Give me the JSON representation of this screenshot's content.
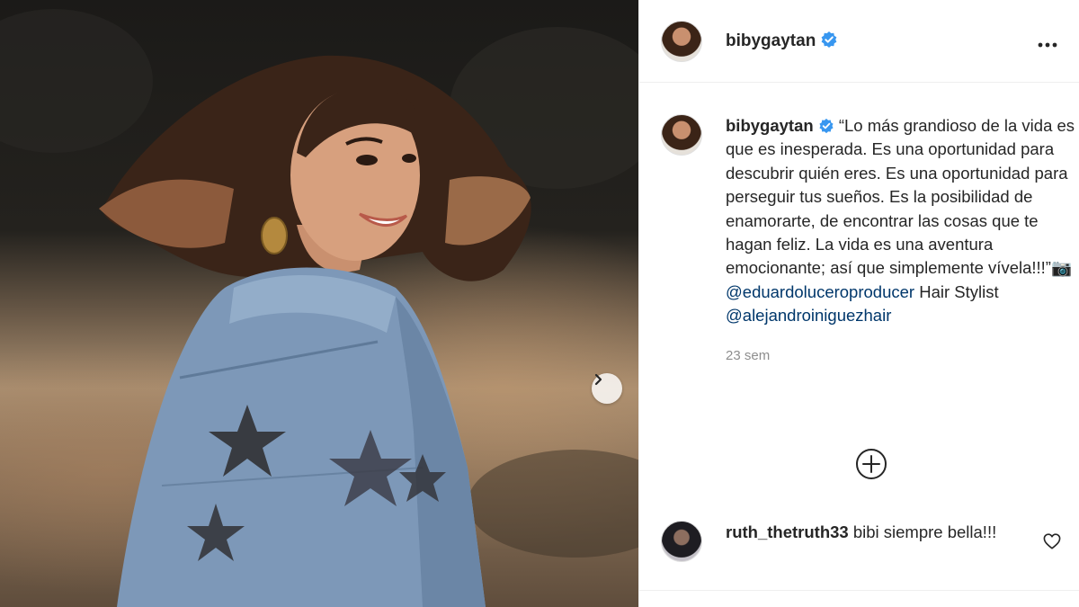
{
  "post": {
    "username": "bibygaytan",
    "verified": true,
    "more_icon": "more-horizontal-icon",
    "image": {
      "description_icon": "photo",
      "next_icon": "chevron-right-icon"
    }
  },
  "caption": {
    "username": "bibygaytan",
    "text": "“Lo más grandioso de la vida es que es inesperada. Es una oportunidad para descubrir quién eres. Es una oportunidad para perseguir tus sueños. Es la posibilidad de enamorarte, de encontrar las cosas que te hagan feliz. La vida es una aventura emocionante; así que simplemente vívela!!!”📷",
    "mention_1": "@eduardoluceroproducer",
    "between": " Hair Stylist",
    "mention_2": "@alejandroiniguezhair",
    "time": "23 sem"
  },
  "load_more_icon": "plus-circle-icon",
  "comments": [
    {
      "username": "ruth_thetruth33",
      "text": " bibi siempre bella!!!",
      "like_icon": "heart-icon"
    }
  ],
  "colors": {
    "verified_blue": "#3897f0",
    "mention": "#00376b",
    "muted": "#8e8e8e"
  }
}
